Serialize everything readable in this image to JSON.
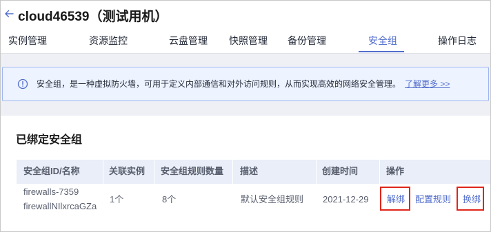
{
  "header": {
    "title": "cloud46539（测试用机）"
  },
  "tabs": [
    {
      "label": "实例管理"
    },
    {
      "label": "资源监控"
    },
    {
      "label": "云盘管理"
    },
    {
      "label": "快照管理"
    },
    {
      "label": "备份管理"
    },
    {
      "label": "安全组",
      "active": true
    },
    {
      "label": "操作日志"
    }
  ],
  "notice": {
    "text": "安全组，是一种虚拟防火墙，可用于定义内部通信和对外访问规则，从而实现高效的网络安全管理。",
    "link": "了解更多 >>"
  },
  "section": {
    "title": "已绑定安全组"
  },
  "table": {
    "columns": [
      "安全组ID/名称",
      "关联实例",
      "安全组规则数量",
      "描述",
      "创建时间",
      "操作"
    ],
    "rows": [
      {
        "id": "firewalls-7359",
        "name": "firewallNIlxrcaGZa",
        "instances": "1个",
        "rules": "8个",
        "description": "默认安全组规则",
        "created": "2021-12-29",
        "actions": {
          "unbind": "解绑",
          "config": "配置规则",
          "rebind": "换绑"
        }
      }
    ]
  },
  "colors": {
    "accent": "#526ecc",
    "highlight_box": "#e0251b",
    "notice_bg": "#edf3ff",
    "table_header_bg": "#e9eef8"
  }
}
